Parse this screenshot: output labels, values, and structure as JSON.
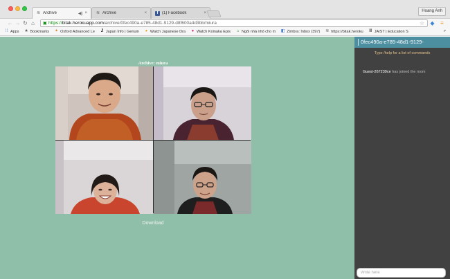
{
  "window": {
    "tabs": [
      {
        "label": "Archive",
        "icon": "wave-favicon",
        "active": true
      },
      {
        "label": "Archive",
        "icon": "wave-favicon",
        "active": false
      },
      {
        "label": "(1) Facebook",
        "icon": "facebook-favicon",
        "active": false
      }
    ],
    "profile_name": "Hoang Anh",
    "active_tab_glyph": "◀)",
    "tab_close_glyph": "×"
  },
  "address_bar": {
    "scheme": "https://",
    "host": "bitak.herokuapp.com",
    "path": "/archive/0fec490a-e785-48d1-9129-d8f600a4d3bb/miura"
  },
  "bookmarks": [
    {
      "label": "Apps",
      "icon": "apps-icon"
    },
    {
      "label": "Bookmarks",
      "icon": "star-icon"
    },
    {
      "label": "Oxford Advanced Le",
      "icon": "oxford-icon"
    },
    {
      "label": "Japan Info | Genuin",
      "icon": "japan-info-icon"
    },
    {
      "label": "Watch Japanese Dra",
      "icon": "drama-icon"
    },
    {
      "label": "Watch Koinaka Epis",
      "icon": "video-icon"
    },
    {
      "label": "Ngôi nhà nhỏ cho m",
      "icon": "house-icon"
    },
    {
      "label": "Zimbra: Inbox (397)",
      "icon": "zimbra-icon"
    },
    {
      "label": "https://bitak.heroku",
      "icon": "wave-icon"
    },
    {
      "label": "JAIST | Education S",
      "icon": "jaist-icon"
    }
  ],
  "bookmarks_more": "»",
  "archive": {
    "title": "Archive: miura",
    "download_label": "Download",
    "participants": [
      "participant-1",
      "participant-2",
      "participant-3",
      "participant-4"
    ]
  },
  "chat": {
    "room_id": "0fec490a-e785-48d1-9129-",
    "help_text": "Type /help for a list of commands",
    "messages": [
      {
        "user": "Guest-267239ce",
        "text": " has joined the room"
      }
    ],
    "input_placeholder": "Write here"
  },
  "colors": {
    "page_background": "#90bfa9",
    "chat_background": "#414141",
    "chat_header": "#4c8fa0",
    "help_text": "#e4c18b"
  }
}
